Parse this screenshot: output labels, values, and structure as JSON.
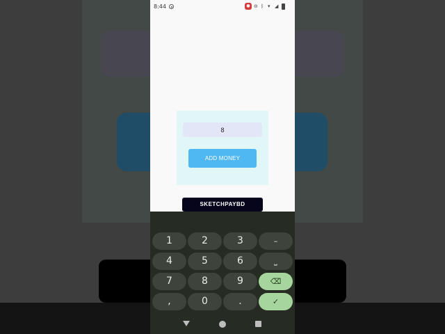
{
  "status_bar": {
    "time": "8:44",
    "icons": [
      "location-icon",
      "screen-record-icon",
      "dnd-icon",
      "bluetooth-icon",
      "wifi-icon",
      "signal-icon",
      "battery-icon"
    ]
  },
  "form": {
    "amount_value": "8",
    "add_button_label": "ADD MONEY"
  },
  "brand": {
    "label": "SKETCHPAYBD"
  },
  "keyboard": {
    "keys": [
      "1",
      "2",
      "3",
      "–",
      "4",
      "5",
      "6",
      "⎵",
      "7",
      "8",
      "9",
      "⌫",
      ",",
      "0",
      ".",
      "✓"
    ]
  },
  "colors": {
    "accent_blue": "#4fb8f2",
    "card_bg": "#e1f7f7",
    "input_bg": "#e3e6f7",
    "brand_bg": "#06051c",
    "keyboard_bg": "#262b24",
    "key_accent": "#a7d59e"
  }
}
